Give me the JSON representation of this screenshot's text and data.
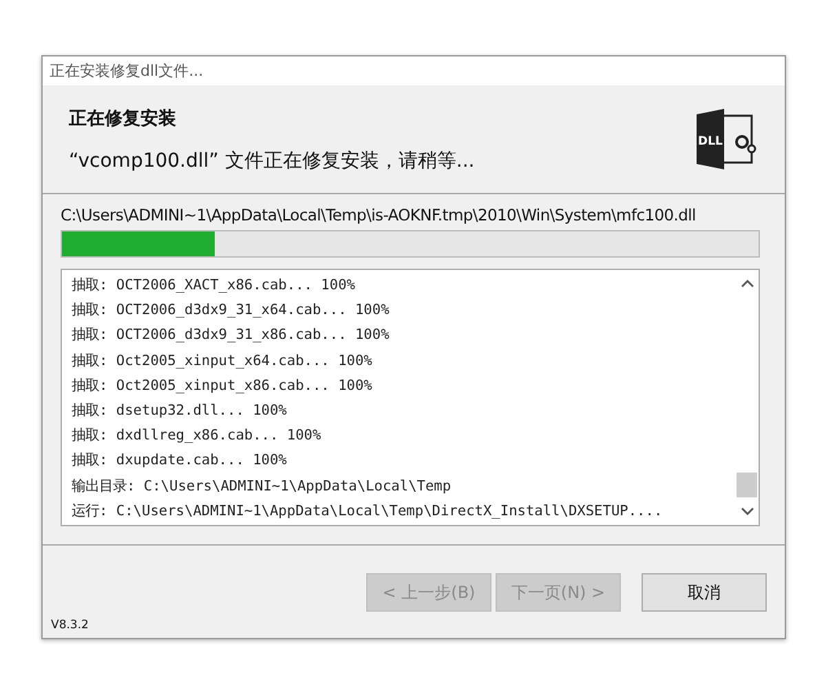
{
  "window": {
    "title": "正在安装修复dll文件..."
  },
  "header": {
    "logo_text": "DLL",
    "title": "正在修复安装",
    "subtitle": "“vcomp100.dll” 文件正在修复安装，请稍等..."
  },
  "current_file": "C:\\Users\\ADMINI~1\\AppData\\Local\\Temp\\is-AOKNF.tmp\\2010\\Win\\System\\mfc100.dll",
  "progress": {
    "level": 0.22
  },
  "log": [
    "抽取: OCT2006_XACT_x86.cab... 100%",
    "抽取: OCT2006_d3dx9_31_x64.cab... 100%",
    "抽取: OCT2006_d3dx9_31_x86.cab... 100%",
    "抽取: Oct2005_xinput_x64.cab... 100%",
    "抽取: Oct2005_xinput_x86.cab... 100%",
    "抽取: dsetup32.dll... 100%",
    "抽取: dxdllreg_x86.cab... 100%",
    "抽取: dxupdate.cab... 100%",
    "输出目录: C:\\Users\\ADMINI~1\\AppData\\Local\\Temp",
    "运行: C:\\Users\\ADMINI~1\\AppData\\Local\\Temp\\DirectX_Install\\DXSETUP...."
  ],
  "buttons": [
    {
      "label": "< 上一步(B)",
      "disabled": true
    },
    {
      "label": "下一页(N) >",
      "disabled": true
    },
    {
      "label": "取消",
      "disabled": false
    }
  ],
  "version": "V8.3.2"
}
